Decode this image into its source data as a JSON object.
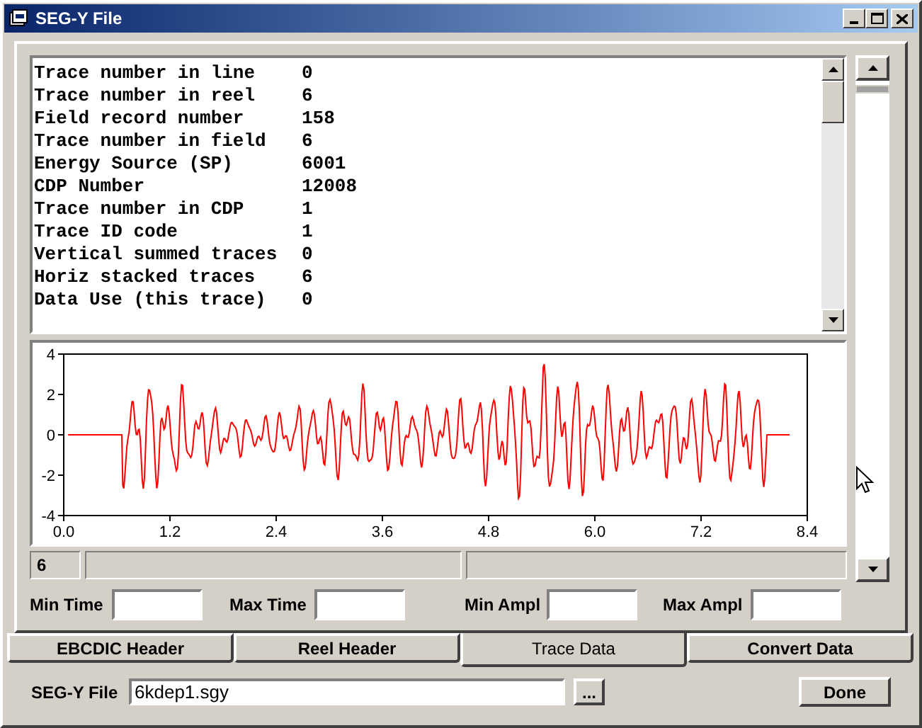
{
  "window": {
    "title": "SEG-Y File"
  },
  "trace_header": {
    "rows": [
      {
        "label": "Trace number in line",
        "value": "0"
      },
      {
        "label": "Trace number in reel",
        "value": "6"
      },
      {
        "label": "Field record number",
        "value": "158"
      },
      {
        "label": "Trace number in field",
        "value": "6"
      },
      {
        "label": "Energy Source (SP)",
        "value": "6001"
      },
      {
        "label": "CDP Number",
        "value": "12008"
      },
      {
        "label": "Trace number in CDP",
        "value": "1"
      },
      {
        "label": "Trace ID code",
        "value": "1"
      },
      {
        "label": "Vertical summed traces",
        "value": "0"
      },
      {
        "label": "Horiz stacked traces",
        "value": "6"
      },
      {
        "label": "Data Use (this trace)",
        "value": "0"
      }
    ]
  },
  "plot": {
    "y_ticks": [
      "4",
      "2",
      "0",
      "-2",
      "-4"
    ],
    "x_ticks": [
      "0.0",
      "1.2",
      "2.4",
      "3.6",
      "4.8",
      "6.0",
      "7.2",
      "8.4"
    ]
  },
  "status_bar": {
    "cell_1": "6"
  },
  "range_fields": [
    {
      "label": "Min Time"
    },
    {
      "label": "Max Time"
    },
    {
      "label": "Min Ampl"
    },
    {
      "label": "Max Ampl"
    }
  ],
  "tabs": [
    {
      "label": "EBCDIC Header",
      "selected": false
    },
    {
      "label": "Reel Header",
      "selected": false
    },
    {
      "label": "Trace Data",
      "selected": true
    },
    {
      "label": "Convert Data",
      "selected": false
    }
  ],
  "file": {
    "label": "SEG-Y File",
    "value": "6kdep1.sgy"
  },
  "buttons": {
    "browse": "...",
    "done": "Done"
  }
}
